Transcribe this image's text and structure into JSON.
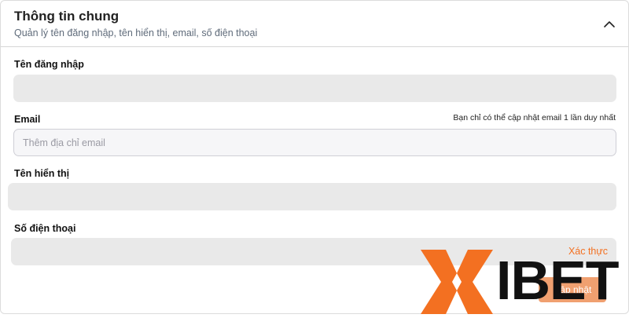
{
  "header": {
    "title": "Thông tin chung",
    "subtitle": "Quản lý tên đăng nhập, tên hiển thị, email, số điện thoại"
  },
  "fields": {
    "username": {
      "label": "Tên đăng nhập",
      "value": ""
    },
    "email": {
      "label": "Email",
      "note": "Bạn chỉ có thể cập nhật email 1 lần duy nhất",
      "placeholder": "Thêm địa chỉ email",
      "value": ""
    },
    "display_name": {
      "label": "Tên hiển thị",
      "value": ""
    },
    "phone": {
      "label": "Số điện thoại",
      "value": "",
      "verify_label": "Xác thực"
    }
  },
  "overlay": {
    "logo_text": "IBET",
    "partially_hidden_button": "Cập nhật"
  },
  "colors": {
    "accent": "#f37021",
    "logo_orange": "#f37021",
    "field_readonly": "#e9e9e9",
    "text_muted": "#5f6b7a"
  },
  "icons": {
    "collapse": "chevron-up-icon",
    "logo_mark": "x-logo-icon"
  }
}
